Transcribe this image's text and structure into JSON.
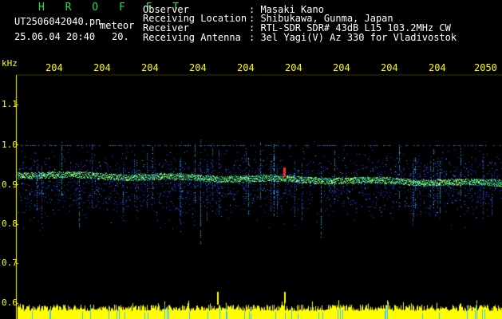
{
  "header": {
    "title": "H R O F F T",
    "filename": "UT2506042040.pn",
    "tag": "meteor",
    "datetime": "25.06.04 20:40",
    "counter": "20.",
    "observer_label": "Observer",
    "observer_value": ": Masaki Kano",
    "location_label": "Receiving Location",
    "location_value": ": Shibukawa, Gunma, Japan",
    "receiver_label": "Receiver",
    "receiver_value": ": RTL-SDR SDR# 43dB L15 103.2MHz CW",
    "antenna_label": "Receiving Antenna",
    "antenna_value": ": 3el Yagi(V) Az 330 for Vladivostok"
  },
  "axis": {
    "unit": "kHz",
    "time_ticks": [
      "204",
      "204",
      "204",
      "204",
      "204",
      "204",
      "204",
      "204",
      "204",
      "2050"
    ],
    "freq_ticks": [
      "1.1",
      "1.0",
      "0.9",
      "0.8",
      "0.7",
      "0.6"
    ]
  },
  "colors": {
    "axis": "#ffff00",
    "text": "#ffffff",
    "title": "#1fe05a",
    "noise": "#1a3cff",
    "signal": "#20c080",
    "peak": "#ff3030",
    "activity": "#ffff00"
  }
}
